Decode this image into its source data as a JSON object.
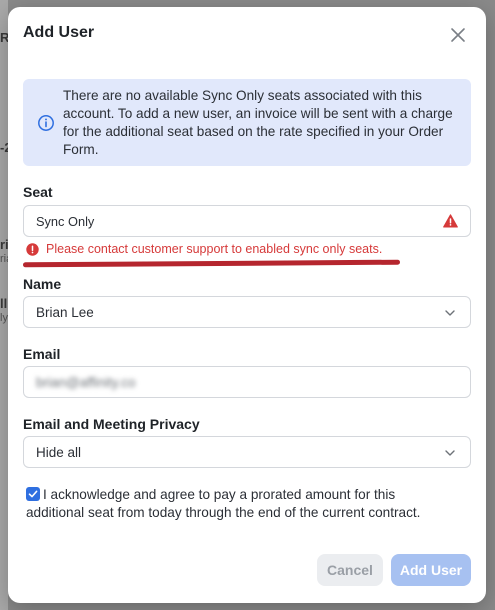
{
  "background": {
    "fragments": [
      "R",
      "-2",
      "ri",
      "ria",
      "ll",
      "ly"
    ]
  },
  "modal": {
    "title": "Add User",
    "close_icon": "close-icon",
    "info_banner": {
      "icon": "info-icon",
      "text": "There are no available Sync Only seats associated with this account. To add a new user, an invoice will be sent with a charge for the additional seat based on the rate specified in your Order Form."
    },
    "seat": {
      "label": "Seat",
      "value": "Sync Only",
      "warning_icon": "warning-icon",
      "error": "Please contact customer support to enabled sync only seats."
    },
    "name": {
      "label": "Name",
      "value": "Brian Lee"
    },
    "email": {
      "label": "Email",
      "value": "brian@affinity.co"
    },
    "privacy": {
      "label": "Email and Meeting Privacy",
      "value": "Hide all"
    },
    "acknowledge": {
      "checked": true,
      "text": "I acknowledge and agree to pay a prorated amount for this additional seat from today through the end of the current contract."
    },
    "buttons": {
      "cancel": "Cancel",
      "add_user": "Add User"
    }
  },
  "colors": {
    "accent": "#2f6fe0",
    "error": "#d63a3a",
    "info_bg": "#e1e8fb",
    "primary_disabled": "#a7c1f1"
  }
}
